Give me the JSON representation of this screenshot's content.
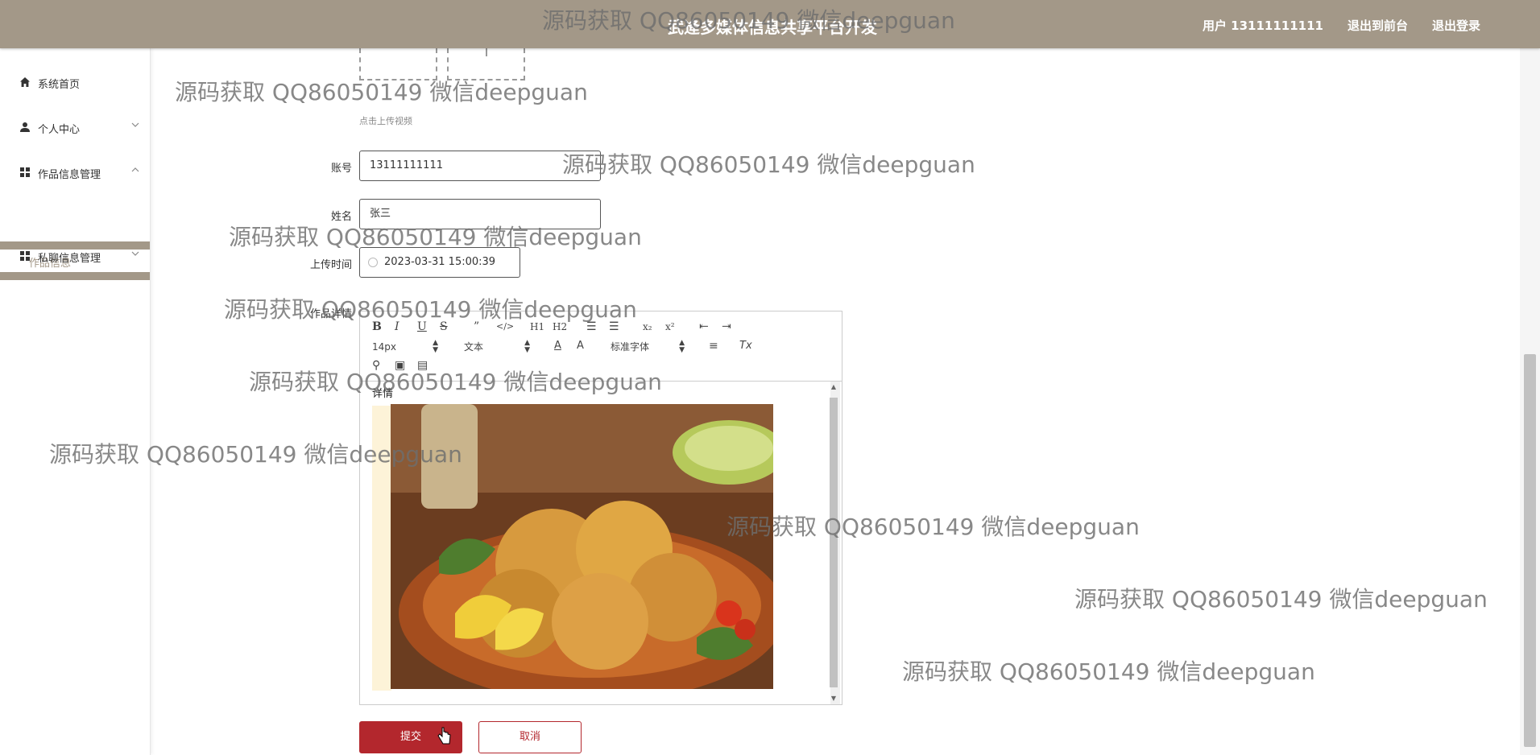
{
  "header": {
    "title": "武逄多媒体信息共享平台开发",
    "nav": [
      {
        "label": "用户 13111111111"
      },
      {
        "label": "退出到前台"
      },
      {
        "label": "退出登录"
      }
    ]
  },
  "sidebar": {
    "items": [
      {
        "label": "系统首页",
        "icon": "home-icon"
      },
      {
        "label": "个人中心",
        "icon": "user-icon"
      },
      {
        "label": "作品信息管理",
        "icon": "grid-icon"
      },
      {
        "label": "私聊信息管理",
        "icon": "grid-icon"
      }
    ],
    "subitem": "作品信息"
  },
  "form": {
    "upload_hint": "点击上传视频",
    "account_label": "账号",
    "account_value": "13111111111",
    "name_label": "姓名",
    "name_value": "张三",
    "time_label": "上传时间",
    "time_value": "2023-03-31 15:00:39",
    "detail_label": "作品详情",
    "editor": {
      "font_size": "14px",
      "header_select": "文本",
      "font_family": "标准字体",
      "content_text": "详情",
      "image_subject": "fried-chicken-photo"
    },
    "submit_label": "提交",
    "cancel_label": "取消"
  },
  "watermark": {
    "text": "源码获取 QQ86050149 微信deepguan"
  },
  "colors": {
    "header_bg": "#a39888",
    "accent": "#b3272d",
    "sub_active": "#a39888"
  }
}
